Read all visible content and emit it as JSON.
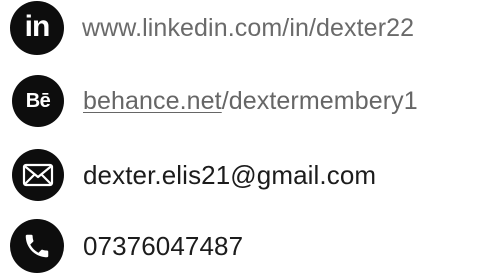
{
  "contacts": {
    "linkedin": {
      "icon": "linkedin-icon",
      "icon_text": "in",
      "text": "www.linkedin.com/in/dexter22"
    },
    "behance": {
      "icon": "behance-icon",
      "icon_text": "Bē",
      "link_part": "behance.net",
      "rest_part": "/dextermembery1"
    },
    "email": {
      "icon": "envelope-icon",
      "text": "dexter.elis21@gmail.com"
    },
    "phone": {
      "icon": "phone-icon",
      "text": "07376047487"
    }
  },
  "colors": {
    "icon_background": "#0d0d0d",
    "icon_foreground": "#ffffff",
    "primary_text": "#1c1c1c",
    "secondary_text": "#6a6a6a"
  }
}
